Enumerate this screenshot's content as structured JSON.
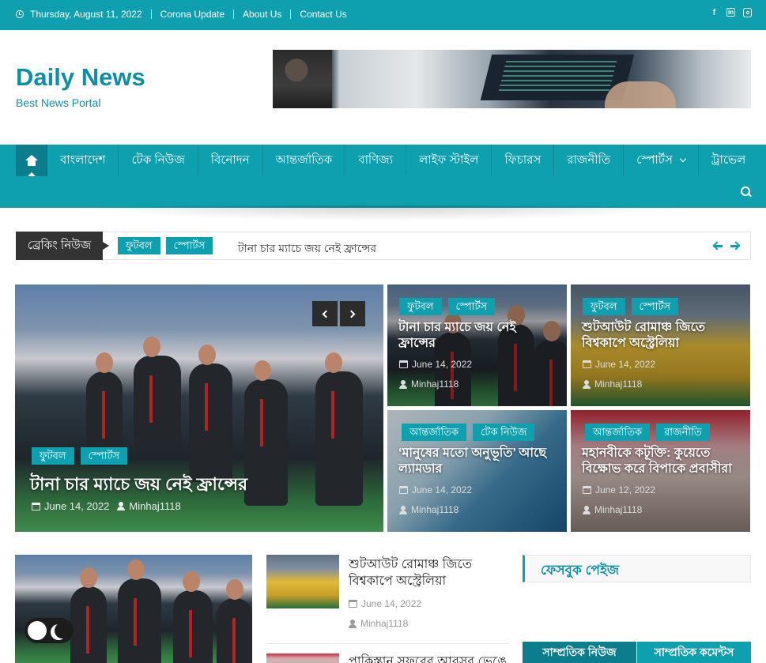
{
  "topbar": {
    "date": "Thursday, August 11, 2022",
    "links": [
      "Corona Update",
      "About Us",
      "Contact Us"
    ],
    "social_icons": [
      "facebook-icon",
      "linkedin-icon",
      "instagram-icon"
    ]
  },
  "brand": {
    "title": "Daily News",
    "tagline": "Best News Portal"
  },
  "nav": {
    "home_icon": "home-icon",
    "items": [
      "বাংলাদেশ",
      "টেক নিউজ",
      "বিনোদন",
      "আন্তর্জাতিক",
      "বাণিজ্য",
      "লাইফ স্টাইল",
      "ফিচারস",
      "রাজনীতি",
      "স্পোর্টস",
      "ট্রাভেল"
    ]
  },
  "breaking": {
    "label": "ব্রেকিং নিউজ",
    "tags": [
      "ফুটবল",
      "স্পোর্টস"
    ],
    "headline": "টানা চার ম্যাচে জয় নেই ফ্রান্সের"
  },
  "hero": {
    "tags": [
      "ফুটবল",
      "স্পোর্টস"
    ],
    "title": "টানা চার ম্যাচে জয় নেই ফ্রান্সের",
    "date": "June 14, 2022",
    "author": "Minhaj1118"
  },
  "cards": [
    {
      "tags": [
        "ফুটবল",
        "স্পোর্টস"
      ],
      "title": "টানা চার ম্যাচে জয় নেই ফ্রান্সের",
      "date": "June 14, 2022",
      "author": "Minhaj1118"
    },
    {
      "tags": [
        "ফুটবল",
        "স্পোর্টস"
      ],
      "title": "শুটআউট রোমাঞ্চ জিতে বিশ্বকাপে অস্ট্রেলিয়া",
      "date": "June 14, 2022",
      "author": "Minhaj1118"
    },
    {
      "tags": [
        "আন্তর্জাতিক",
        "টেক নিউজ"
      ],
      "title": "‘মানুষের মতো অনুভূতি’ আছে ল্যামডার",
      "date": "June 14, 2022",
      "author": "Minhaj1118"
    },
    {
      "tags": [
        "আন্তর্জাতিক",
        "রাজনীতি"
      ],
      "title": "মহানবীকে কটূক্তি: কুয়েতে বিক্ষোভ করে বিপাকে প্রবাসীরা",
      "date": "June 12, 2022",
      "author": "Minhaj1118"
    }
  ],
  "list": {
    "item1": {
      "title": "শুটআউট রোমাঞ্চ জিতে বিশ্বকাপে অস্ট্রেলিয়া",
      "date": "June 14, 2022",
      "author": "Minhaj1118"
    },
    "item2": {
      "title": "পাকিস্তান সফরের আবসর ভেঙে"
    }
  },
  "sidebar": {
    "facebook_title": "ফেসবুক পেইজ",
    "tabs": [
      "সাম্প্রতিক নিউজ",
      "সাম্প্রতিক কমেন্টস"
    ]
  },
  "colors": {
    "accent": "#0fa0b0",
    "accent_dark": "#0b7d8c",
    "brand": "#0e8fa3"
  }
}
